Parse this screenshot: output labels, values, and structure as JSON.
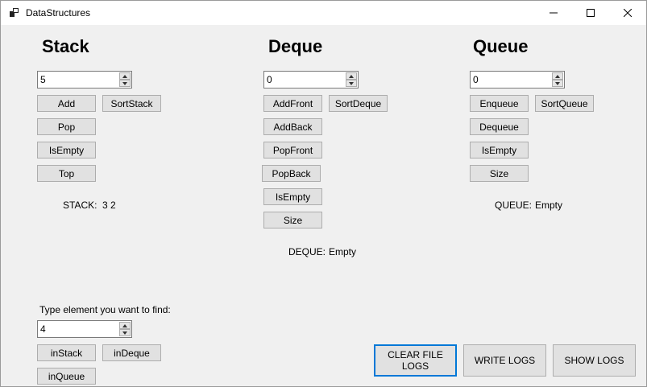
{
  "window": {
    "title": "DataStructures"
  },
  "stack": {
    "heading": "Stack",
    "input_value": "5",
    "buttons": {
      "add": "Add",
      "sort": "SortStack",
      "pop": "Pop",
      "is_empty": "IsEmpty",
      "top": "Top"
    },
    "status_label": "STACK:",
    "status_value": "3 2"
  },
  "deque": {
    "heading": "Deque",
    "input_value": "0",
    "buttons": {
      "add_front": "AddFront",
      "sort": "SortDeque",
      "add_back": "AddBack",
      "pop_front": "PopFront",
      "pop_back": "PopBack",
      "is_empty": "IsEmpty",
      "size": "Size"
    },
    "status_label": "DEQUE:",
    "status_value": "Empty"
  },
  "queue": {
    "heading": "Queue",
    "input_value": "0",
    "buttons": {
      "enqueue": "Enqueue",
      "sort": "SortQueue",
      "dequeue": "Dequeue",
      "is_empty": "IsEmpty",
      "size": "Size"
    },
    "status_label": "QUEUE:",
    "status_value": "Empty"
  },
  "find": {
    "prompt": "Type element you want to find:",
    "input_value": "4",
    "buttons": {
      "in_stack": "inStack",
      "in_deque": "inDeque",
      "in_queue": "inQueue"
    }
  },
  "logs": {
    "clear": "CLEAR FILE LOGS",
    "write": "WRITE LOGS",
    "show": "SHOW LOGS"
  }
}
